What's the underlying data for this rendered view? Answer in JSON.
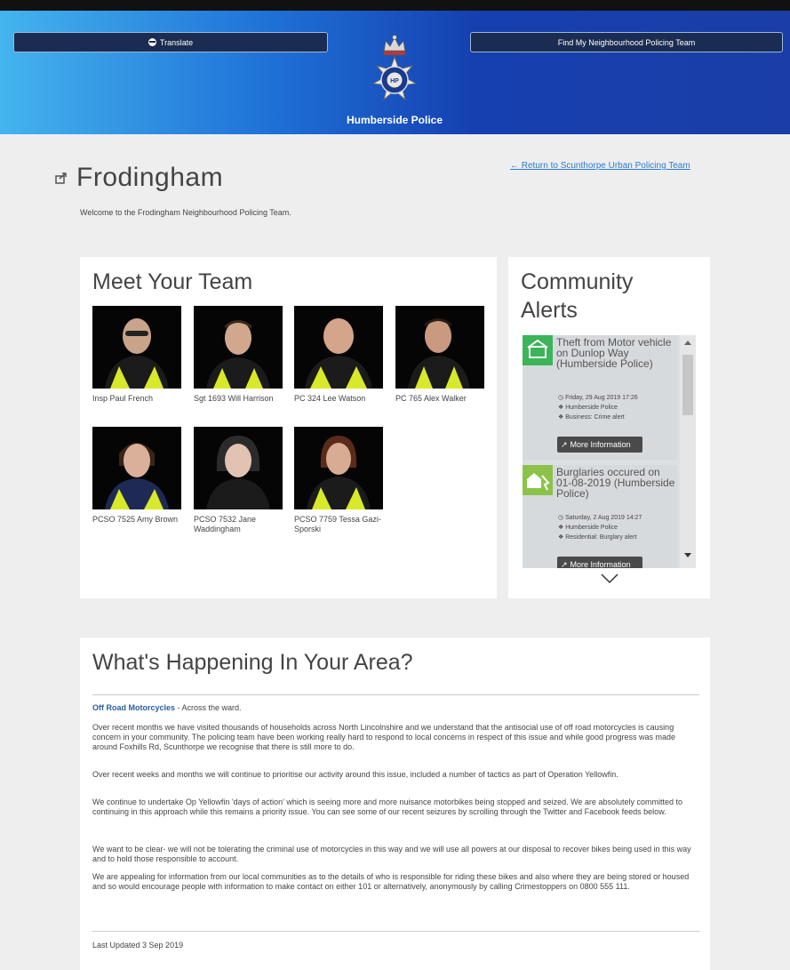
{
  "header": {
    "translate_label": "Translate",
    "find_team_label": "Find My Neighbourhood Policing Team",
    "brand": "Humberside Police",
    "badge_text_top": "HUMBERSIDE",
    "badge_text_bottom": "POLICE",
    "colors": {
      "gradient_start": "#44b4ee",
      "gradient_end": "#1a3ea6",
      "button_bg": "#1a2c52"
    }
  },
  "page": {
    "title": "Frodingham",
    "return_link": "← Return to Scunthorpe Urban Policing Team",
    "welcome": "Welcome to the Frodingham Neighbourhood Policing Team."
  },
  "team": {
    "heading": "Meet Your Team",
    "members": [
      {
        "name": "Insp Paul French"
      },
      {
        "name": "Sgt 1693 Will Harrison"
      },
      {
        "name": "PC 324 Lee Watson"
      },
      {
        "name": "PC 765 Alex Walker"
      },
      {
        "name": "PCSO 7525 Amy Brown"
      },
      {
        "name": "PCSO 7532 Jane Waddingham"
      },
      {
        "name": "PCSO 7759 Tessa Gazi-Sporski"
      }
    ]
  },
  "alerts": {
    "heading": "Community Alerts",
    "items": [
      {
        "title": "Theft from Motor vehicle on Dunlop Way (Humberside Police)",
        "date": "Friday, 29 Aug 2019 17:26",
        "source": "Humberside Police",
        "category": "Business: Crime alert",
        "button": "More Information"
      },
      {
        "title": "Burglaries occured on 01-08-2019 (Humberside Police)",
        "date": "Saturday, 2 Aug 2019 14:27",
        "source": "Humberside Police",
        "category": "Residential: Burglary alert",
        "button": "More Information"
      }
    ]
  },
  "area": {
    "heading": "What's Happening In Your Area?",
    "topic_title": "Off Road Motorcycles",
    "topic_suffix": " - Across the ward.",
    "paragraphs": [
      "Over recent months we have visited thousands of households across North Lincolnshire and we understand that the antisocial use of off road motorcycles is causing concern in your community. The policing team have been working really hard to respond to local concerns in respect of this issue and while good progress was made around Foxhills Rd, Scunthorpe we recognise that there is still more to do.",
      "Over recent weeks and months we will continue to prioritise our activity around this issue, included a number of tactics as part of Operation Yellowfin.",
      "We continue to undertake Op Yellowfin 'days of action' which is seeing more and more nuisance motorbikes being stopped and seized. We are absolutely committed to continuing in this approach while this remains a priority issue. You can see some of our recent seizures by scrolling through the Twitter and Facebook feeds below.",
      "We want to be clear- we will not be tolerating the criminal use of motorcycles in this way and we will use all powers at our disposal to recover bikes being used in this way and to hold those responsible to account.",
      "We are appealing for information from our local communities as to the details of who is responsible for riding these bikes and also where they are being stored or housed and so would encourage people with information to make contact on either 101 or alternatively, anonymously by calling Crimestoppers on 0800 555 111."
    ],
    "last_updated": "Last Updated 3 Sep 2019"
  }
}
